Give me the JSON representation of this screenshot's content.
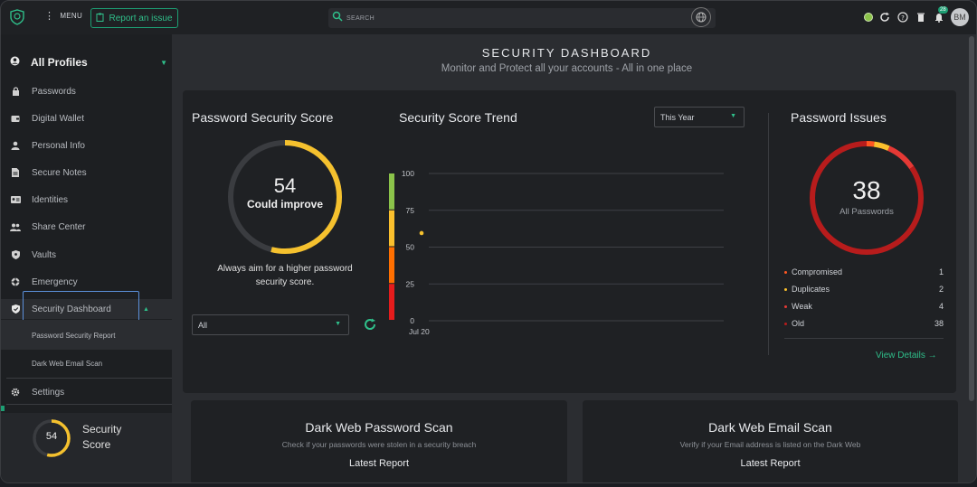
{
  "topbar": {
    "menu_label": "MENU",
    "report_label": "Report an issue",
    "search_placeholder": "SEARCH",
    "notification_count": "28",
    "avatar_initials": "BM"
  },
  "sidebar": {
    "profile_label": "All Profiles",
    "items": [
      {
        "label": "Passwords",
        "icon": "lock-icon"
      },
      {
        "label": "Digital Wallet",
        "icon": "wallet-icon"
      },
      {
        "label": "Personal Info",
        "icon": "person-icon"
      },
      {
        "label": "Secure Notes",
        "icon": "note-icon"
      },
      {
        "label": "Identities",
        "icon": "id-card-icon"
      },
      {
        "label": "Share Center",
        "icon": "share-people-icon"
      },
      {
        "label": "Vaults",
        "icon": "shield-icon"
      },
      {
        "label": "Emergency",
        "icon": "lifebuoy-icon"
      },
      {
        "label": "Security Dashboard",
        "icon": "security-shield-icon"
      }
    ],
    "sub_items": [
      "Password Security Report",
      "Dark Web Email Scan"
    ],
    "settings_label": "Settings",
    "score_value": "54",
    "score_label_line1": "Security",
    "score_label_line2": "Score",
    "score_fraction": 0.54
  },
  "dashboard": {
    "title": "SECURITY DASHBOARD",
    "subtitle": "Monitor and Protect all your accounts - All in one place",
    "score_card": {
      "title": "Password Security Score",
      "score": "54",
      "status": "Could improve",
      "hint": "Always aim for a higher password security score.",
      "filter_value": "All",
      "score_fraction": 0.54
    },
    "trend": {
      "title": "Security Score Trend",
      "range_value": "This Year"
    },
    "issues": {
      "title": "Password Issues",
      "total": "38",
      "total_label": "All Passwords",
      "rows": [
        {
          "label": "Compromised",
          "value": "1",
          "color": "#ff5722"
        },
        {
          "label": "Duplicates",
          "value": "2",
          "color": "#fbc02d"
        },
        {
          "label": "Weak",
          "value": "4",
          "color": "#e53935"
        },
        {
          "label": "Old",
          "value": "38",
          "color": "#b71c1c"
        }
      ],
      "view_details": "View Details →"
    },
    "dark_web_password": {
      "title": "Dark Web  Password Scan",
      "subtitle": "Check if your passwords were stolen in a security breach",
      "latest": "Latest Report"
    },
    "dark_web_email": {
      "title": "Dark Web  Email Scan",
      "subtitle": "Verify if your Email address is listed on the Dark Web",
      "latest": "Latest Report"
    }
  },
  "chart_data": {
    "type": "line",
    "title": "Security Score Trend",
    "x": [
      "Jul 20"
    ],
    "series": [
      {
        "values": [
          54
        ]
      }
    ],
    "yticks": [
      "100",
      "75",
      "50",
      "25",
      "0"
    ],
    "ylim": [
      0,
      100
    ],
    "grid": true,
    "scale_colors": [
      "#8bc34a",
      "#fbc02d",
      "#ff6f00",
      "#e51c1c"
    ]
  }
}
